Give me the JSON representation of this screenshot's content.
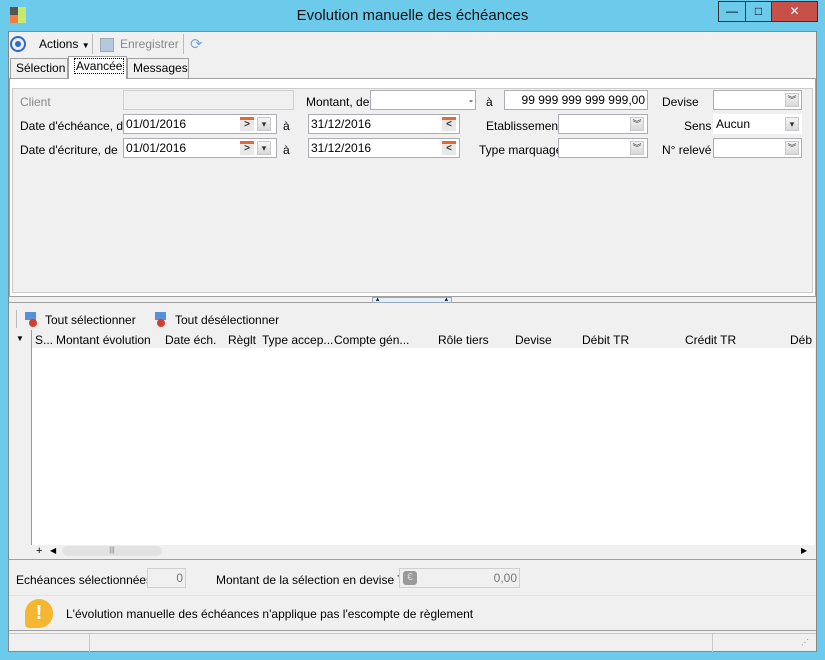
{
  "window": {
    "title": "Evolution manuelle des échéances",
    "minimize": "—",
    "maximize": "□",
    "close": "✕"
  },
  "toolbar": {
    "actions": "Actions",
    "save": "Enregistrer"
  },
  "tabs": [
    {
      "label": "Sélection"
    },
    {
      "label": "Avancée",
      "active": true
    },
    {
      "label": "Messages"
    }
  ],
  "form": {
    "client_label": "Client",
    "client_value": "",
    "montant_label": "Montant, de",
    "montant_from": "-",
    "a_label": "à",
    "montant_to": "99 999 999 999 999,00",
    "devise_label": "Devise",
    "devise_value": "",
    "date_echeance_label": "Date d'échéance, de",
    "date_echeance_from": "01/01/2016",
    "date_echeance_to": "31/12/2016",
    "etablissement_label": "Etablissement",
    "etablissement_value": "",
    "sens_label": "Sens",
    "sens_value": "Aucun",
    "date_ecriture_label": "Date d'écriture, de",
    "date_ecriture_from": "01/01/2016",
    "date_ecriture_to": "31/12/2016",
    "type_marquage_label": "Type marquage",
    "type_marquage_value": "",
    "releve_label": "N° relevé",
    "releve_value": ""
  },
  "grid": {
    "select_all": "Tout sélectionner",
    "deselect_all": "Tout désélectionner",
    "columns": [
      "S...",
      "Montant évolution",
      "Date éch.",
      "Règlt",
      "Type accep...",
      "Compte gén...",
      "Rôle tiers",
      "Devise",
      "Débit TR",
      "Crédit TR",
      "Déb"
    ],
    "rows": []
  },
  "summary": {
    "selected_label": "Echéances sélectionnées",
    "selected_count": "0",
    "amount_label": "Montant de la sélection en devise TC",
    "amount_value": "0,00"
  },
  "message": {
    "text": "L'évolution manuelle des échéances n'applique pas l'escompte de règlement"
  },
  "colors": {
    "window_border": "#6ccbea",
    "warning": "#f5b731"
  }
}
